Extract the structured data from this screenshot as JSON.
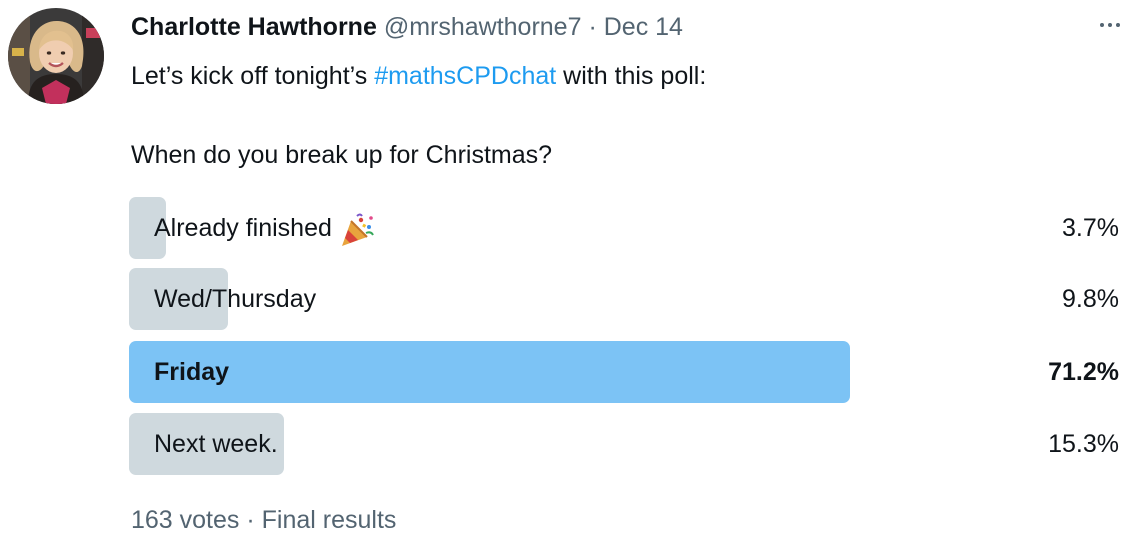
{
  "tweet": {
    "author_name": "Charlotte Hawthorne",
    "handle": "@mrshawthorne7",
    "separator": "·",
    "date": "Dec 14",
    "text_before_hashtag": "Let’s kick off tonight’s ",
    "hashtag": "#mathsCPDchat",
    "text_after_hashtag": " with this poll:",
    "question": "When do you break up for Christmas?"
  },
  "poll": {
    "options": [
      {
        "label": "Already finished",
        "percent_label": "3.7%",
        "percent": 3.7,
        "winner": false,
        "icon": "party-popper-icon"
      },
      {
        "label": "Wed/Thursday",
        "percent_label": "9.8%",
        "percent": 9.8,
        "winner": false
      },
      {
        "label": "Friday",
        "percent_label": "71.2%",
        "percent": 71.2,
        "winner": true
      },
      {
        "label": "Next week.",
        "percent_label": "15.3%",
        "percent": 15.3,
        "winner": false
      }
    ],
    "votes": "163 votes",
    "separator": "·",
    "status": "Final results"
  },
  "colors": {
    "bar": "#cfd9de",
    "winner_bar": "#7cc3f5",
    "hashtag": "#1d9bf0",
    "muted_text": "#536471"
  },
  "icons": {
    "more": "more-options-icon",
    "avatar": "profile-avatar"
  }
}
